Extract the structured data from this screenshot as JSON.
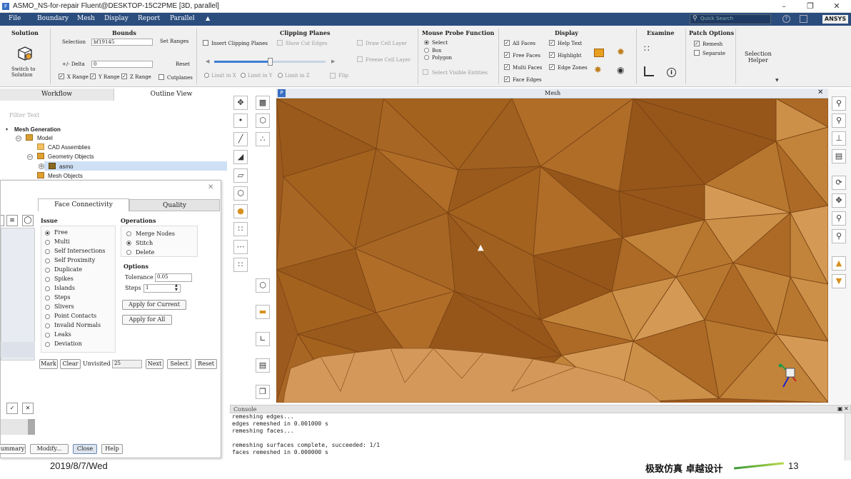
{
  "window": {
    "title": "ASMO_NS-for-repair Fluent@DESKTOP-15C2PME  [3D, parallel]",
    "app_badge": "ANSYS"
  },
  "menu": [
    "File",
    "Boundary",
    "Mesh",
    "Display",
    "Report",
    "Parallel"
  ],
  "quick_search": {
    "placeholder": "Quick Search"
  },
  "ribbon": {
    "solution": {
      "title": "Solution",
      "switch_label_1": "Switch to",
      "switch_label_2": "Solution"
    },
    "bounds": {
      "title": "Bounds",
      "selection_label": "Selection",
      "selection_value": "bf19145",
      "set_ranges": "Set Ranges",
      "delta_label": "+/- Delta",
      "delta_value": "0",
      "reset": "Reset",
      "x_range": "X Range",
      "y_range": "Y Range",
      "z_range": "Z Range",
      "cutplanes": "Cutplanes"
    },
    "clipping": {
      "title": "Clipping Planes",
      "insert": "Insert Clipping Planes",
      "show_cut_edges": "Show Cut Edges",
      "draw_cell_layer": "Draw Cell Layer",
      "freeze_cell_layer": "Freeze Cell Layer",
      "limit_x": "Limit in X",
      "limit_y": "Limit in Y",
      "limit_z": "Limit in Z",
      "flip": "Flip"
    },
    "mouse_probe": {
      "title": "Mouse Probe Function",
      "select": "Select",
      "box": "Box",
      "polygon": "Polygon",
      "select_visible": "Select Visible Entities"
    },
    "display": {
      "title": "Display",
      "all_faces": "All Faces",
      "free_faces": "Free Faces",
      "multi_faces": "Multi Faces",
      "face_edges": "Face Edges",
      "help_text": "Help Text",
      "highlight": "Highlight",
      "edge_zones": "Edge Zones"
    },
    "examine": {
      "title": "Examine"
    },
    "patch": {
      "title": "Patch Options",
      "remesh": "Remesh",
      "separate": "Separate"
    },
    "selection_helper": {
      "line1": "Selection",
      "line2": "Helper"
    }
  },
  "left_tabs": {
    "workflow": "Workflow",
    "outline": "Outline View"
  },
  "filter": {
    "placeholder": "Filter Text"
  },
  "tree": {
    "root": "Mesh Generation",
    "model": "Model",
    "cad": "CAD Assemblies",
    "geometry": "Geometry Objects",
    "asmo": "asmo",
    "mesh_objects": "Mesh Objects"
  },
  "dialog": {
    "tab_face": "Face Connectivity",
    "tab_quality": "Quality",
    "issue_title": "Issue",
    "issues": [
      "Free",
      "Multi",
      "Self Intersections",
      "Self Proximity",
      "Duplicate",
      "Spikes",
      "Islands",
      "Steps",
      "Slivers",
      "Point Contacts",
      "Invalid Normals",
      "Leaks",
      "Deviation"
    ],
    "operations_title": "Operations",
    "ops": [
      "Merge Nodes",
      "Stitch",
      "Delete"
    ],
    "options_title": "Options",
    "tolerance_label": "Tolerance",
    "tolerance_value": "0.05",
    "steps_label": "Steps",
    "steps_value": "1",
    "apply_current": "Apply for Current",
    "apply_all": "Apply for All",
    "mark": "Mark",
    "clear": "Clear",
    "unvisited_label": "Unvisited",
    "unvisited_value": "25",
    "next": "Next",
    "select": "Select",
    "reset": "Reset",
    "summary": "ummary",
    "modify": "Modify...",
    "close": "Close",
    "help": "Help"
  },
  "graphics": {
    "title": "Mesh",
    "badge": "P",
    "colors": {
      "dark": "#9a5a1c",
      "mid": "#b3702c",
      "light": "#d39a5c"
    }
  },
  "console": {
    "title": "Console",
    "lines": [
      "remeshing edges...",
      "edges remeshed in 0.001000 s",
      "remeshing faces...",
      "",
      "remeshing surfaces complete, succeeded: 1/1",
      "faces remeshed in 0.000000 s"
    ]
  },
  "footer": {
    "date": "2019/8/7/Wed",
    "slogan": "极致仿真 卓越设计",
    "page": "13"
  }
}
